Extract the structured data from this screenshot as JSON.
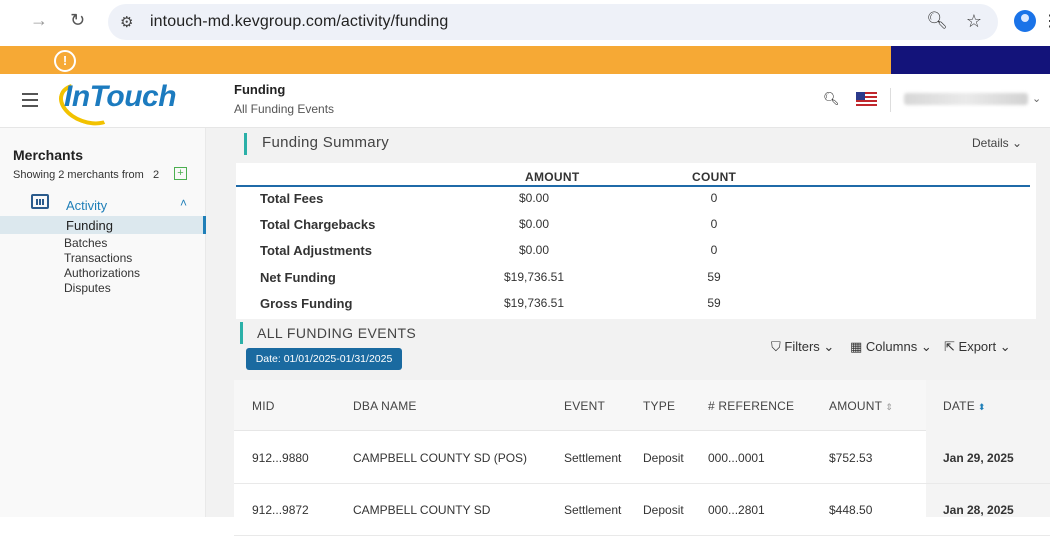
{
  "browser": {
    "url": "intouch-md.kevgroup.com/activity/funding"
  },
  "header": {
    "logo_text": "InTouch",
    "page_title": "Funding",
    "page_subtitle": "All Funding Events"
  },
  "sidebar": {
    "title": "Merchants",
    "showing": "Showing 2 merchants from",
    "count": "2",
    "activity_label": "Activity",
    "items": [
      "Funding",
      "Batches",
      "Transactions",
      "Authorizations",
      "Disputes"
    ]
  },
  "summary": {
    "title": "Funding Summary",
    "details_label": "Details",
    "col_amount": "AMOUNT",
    "col_count": "COUNT",
    "rows": [
      {
        "label": "Total Fees",
        "amount": "$0.00",
        "count": "0"
      },
      {
        "label": "Total Chargebacks",
        "amount": "$0.00",
        "count": "0"
      },
      {
        "label": "Total Adjustments",
        "amount": "$0.00",
        "count": "0"
      },
      {
        "label": "Net Funding",
        "amount": "$19,736.51",
        "count": "59"
      },
      {
        "label": "Gross Funding",
        "amount": "$19,736.51",
        "count": "59"
      }
    ]
  },
  "events": {
    "title": "ALL FUNDING EVENTS",
    "filters_label": "Filters",
    "columns_label": "Columns",
    "export_label": "Export",
    "date_chip": "Date: 01/01/2025-01/31/2025",
    "headers": [
      "MID",
      "DBA NAME",
      "EVENT",
      "TYPE",
      "# REFERENCE",
      "AMOUNT",
      "DATE"
    ],
    "rows": [
      {
        "mid": "912...9880",
        "dba": "CAMPBELL COUNTY SD (POS)",
        "event": "Settlement",
        "type": "Deposit",
        "reference": "000...0001",
        "amount": "$752.53",
        "date": "Jan 29, 2025"
      },
      {
        "mid": "912...9872",
        "dba": "CAMPBELL COUNTY SD",
        "event": "Settlement",
        "type": "Deposit",
        "reference": "000...2801",
        "amount": "$448.50",
        "date": "Jan 28, 2025"
      }
    ]
  },
  "colors": {
    "banner_orange": "#f6a935",
    "banner_navy": "#13137a",
    "accent_blue": "#1f7fb8",
    "teal_bar": "#2bb0a8"
  }
}
